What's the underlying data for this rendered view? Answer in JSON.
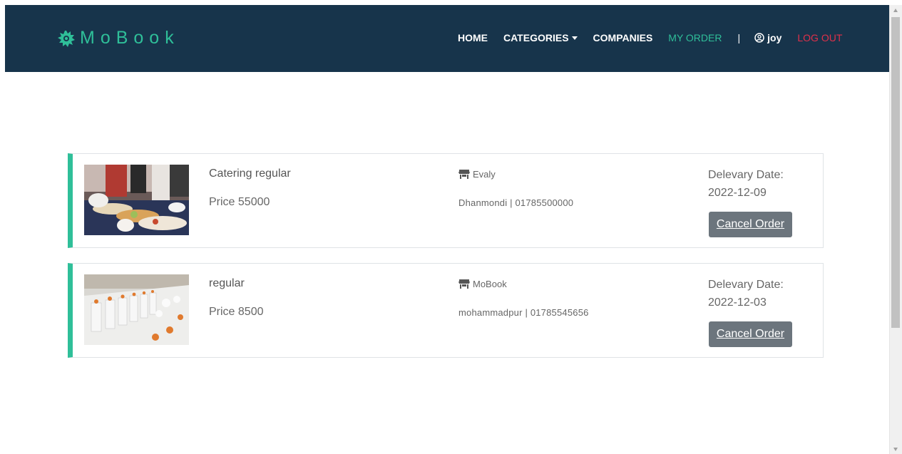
{
  "brand": {
    "name": "MoBook",
    "icon": "splash-logo-icon",
    "color": "#2fbf99"
  },
  "nav": {
    "home": "HOME",
    "categories": "CATEGORIES",
    "companies": "COMPANIES",
    "my_order": "MY ORDER",
    "divider": "|",
    "user": "joy",
    "logout": "LOG OUT"
  },
  "colors": {
    "navbar_bg": "#17344b",
    "accent": "#2fbf99",
    "logout": "#e0304a",
    "button": "#6c757d"
  },
  "orders": [
    {
      "title": "Catering regular",
      "price": "Price 55000",
      "company": "Evaly",
      "address": "Dhanmondi | 01785500000",
      "delivery_label": "Delevary Date:",
      "delivery_date": "2022-12-09",
      "cancel_label": "Cancel Order"
    },
    {
      "title": "regular",
      "price": "Price 8500",
      "company": "MoBook",
      "address": "mohammadpur | 01785545656",
      "delivery_label": "Delevary Date:",
      "delivery_date": "2022-12-03",
      "cancel_label": "Cancel Order"
    }
  ]
}
